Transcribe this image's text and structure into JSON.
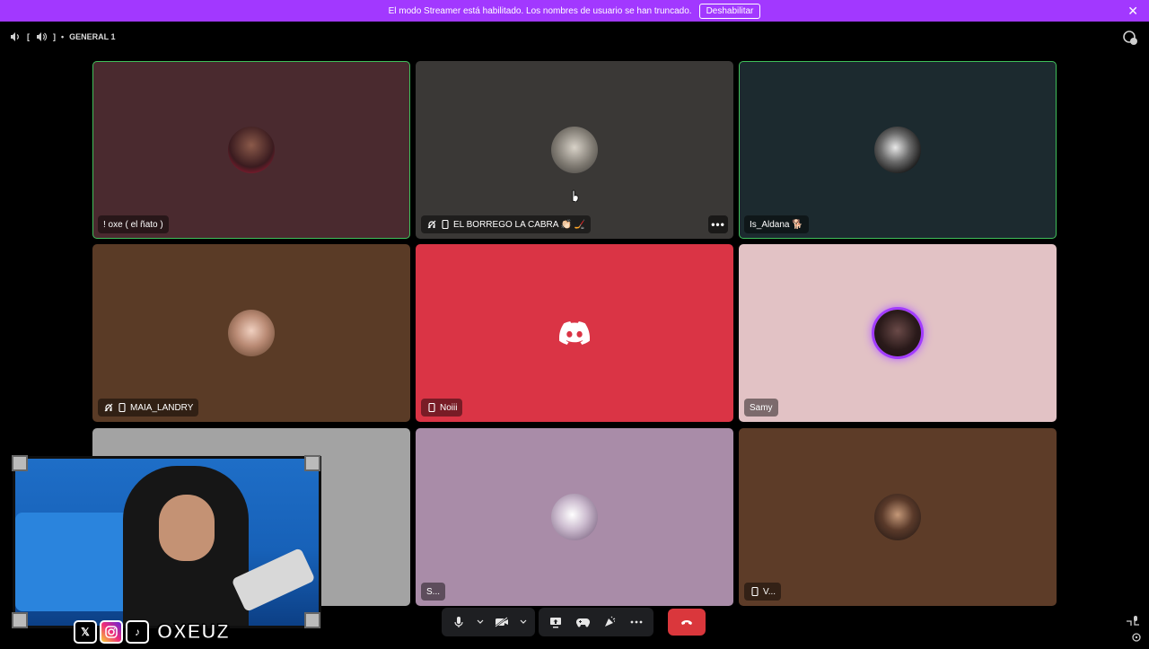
{
  "banner": {
    "message": "El modo Streamer está habilitado. Los nombres de usuario se han truncado.",
    "button_label": "Deshabilitar",
    "close_icon": "close-icon",
    "color": "#a238ff"
  },
  "topbar": {
    "bracket_open": "[",
    "bracket_close": "]",
    "separator": "•",
    "channel_name": "GENERAL 1"
  },
  "participants": [
    {
      "name": "! oxe ( el ñato )",
      "bg": "#4a2a2f",
      "speaking": true,
      "icons": []
    },
    {
      "name": "EL BORREGO LA CABRA 👏🏻 🏒",
      "bg": "#3a3836",
      "speaking": false,
      "icons": [
        "deafened-icon",
        "mobile-icon"
      ],
      "has_menu": true
    },
    {
      "name": "Is_Aldana 🐕",
      "bg": "#1c2a2f",
      "speaking": true,
      "icons": []
    },
    {
      "name": "MAIA_LANDRY",
      "bg": "#5a3b26",
      "speaking": false,
      "icons": [
        "deafened-icon",
        "mobile-icon"
      ]
    },
    {
      "name": "Noiii",
      "bg": "#da3445",
      "speaking": false,
      "icons": [
        "mobile-icon"
      ],
      "default_avatar": true
    },
    {
      "name": "Samy",
      "bg": "#e2c2c5",
      "speaking": false,
      "icons": [],
      "ring": "#a23cff"
    },
    {
      "name": "",
      "bg": "#a3a3a3",
      "speaking": false,
      "icons": []
    },
    {
      "name": "S...",
      "bg": "#a98ca8",
      "speaking": false,
      "icons": []
    },
    {
      "name": "V...",
      "bg": "#5d3c28",
      "speaking": false,
      "icons": [
        "mobile-icon"
      ]
    }
  ],
  "more_label": "•••",
  "controls": {
    "mic": "microphone-icon",
    "camera": "camera-off-icon",
    "screenshare": "screen-share-icon",
    "activities": "gamepad-icon",
    "soundboard": "soundboard-icon",
    "more": "more-icon",
    "disconnect": "hangup-icon",
    "disconnect_color": "#da373c"
  },
  "overlay": {
    "brand": "OXEUZ",
    "socials": [
      "x-icon",
      "instagram-icon",
      "tiktok-icon"
    ],
    "x_glyph": "𝕏",
    "tiktok_glyph": "♪"
  }
}
